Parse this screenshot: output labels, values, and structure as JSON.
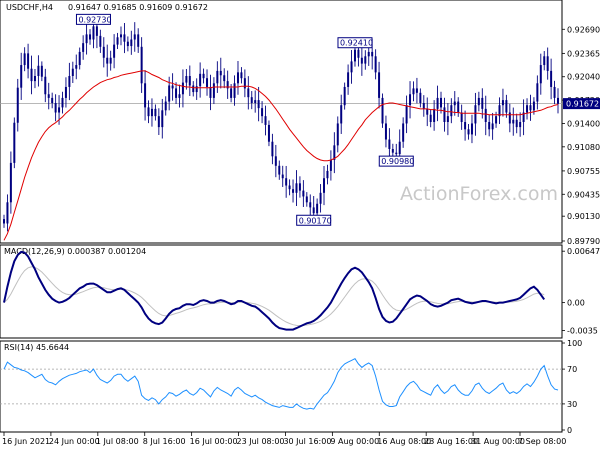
{
  "chart_data": {
    "type": "candlestick",
    "header": {
      "symbol": "USDCHF,H4",
      "ohlc": "0.91647 0.91685 0.91609 0.91672"
    },
    "watermark": "ActionForex.com",
    "colors": {
      "price": "#000080",
      "ma": "#e00000",
      "macd": "#000080",
      "signal": "#c0c0c0",
      "rsi": "#1e90ff",
      "last_price_bg": "#000080",
      "annotation_border": "#000080"
    },
    "x_tick_labels": [
      "16 Jun 2021",
      "24 Jun 00:00",
      "1 Jul 08:00",
      "8 Jul 16:00",
      "16 Jul 00:00",
      "23 Jul 08:00",
      "30 Jul 16:00",
      "9 Aug 00:00",
      "16 Aug 08:00",
      "23 Aug 16:00",
      "31 Aug 00:00",
      "7 Sep 08:00"
    ],
    "price_panel": {
      "ylim": [
        0.8979,
        0.9305
      ],
      "y_ticks": [
        0.9269,
        0.9236,
        0.9204,
        0.9172,
        0.914,
        0.9108,
        0.9075,
        0.9043,
        0.9013,
        0.8979
      ],
      "y_tick_labels": [
        "0.92690",
        "0.92365",
        "0.92040",
        "0.91720",
        "0.91400",
        "0.91080",
        "0.90755",
        "0.90435",
        "0.90130",
        "0.89790"
      ],
      "last_price": 0.91672,
      "last_price_label": "0.91672",
      "annotations": [
        {
          "x_index": 26,
          "value": 0.9273,
          "label": "0.92730",
          "placement": "above"
        },
        {
          "x_index": 90,
          "value": 0.9017,
          "label": "0.90170",
          "placement": "below"
        },
        {
          "x_index": 102,
          "value": 0.9241,
          "label": "0.92410",
          "placement": "above"
        },
        {
          "x_index": 114,
          "value": 0.9098,
          "label": "0.90980",
          "placement": "below"
        }
      ],
      "close": [
        0.9003,
        0.9032,
        0.9086,
        0.9141,
        0.9189,
        0.922,
        0.9236,
        0.9215,
        0.9198,
        0.9205,
        0.9219,
        0.9204,
        0.918,
        0.9175,
        0.9168,
        0.9155,
        0.9162,
        0.9175,
        0.919,
        0.9205,
        0.9215,
        0.922,
        0.9238,
        0.925,
        0.9262,
        0.9255,
        0.9273,
        0.926,
        0.9245,
        0.923,
        0.9222,
        0.923,
        0.9248,
        0.9258,
        0.9262,
        0.9252,
        0.9246,
        0.9255,
        0.9262,
        0.9245,
        0.9195,
        0.9162,
        0.915,
        0.916,
        0.915,
        0.9135,
        0.9158,
        0.917,
        0.9192,
        0.9188,
        0.9175,
        0.918,
        0.9196,
        0.9205,
        0.9192,
        0.9183,
        0.9191,
        0.9208,
        0.9202,
        0.919,
        0.9175,
        0.9195,
        0.9212,
        0.9206,
        0.9198,
        0.9188,
        0.9175,
        0.9195,
        0.921,
        0.9202,
        0.9188,
        0.9176,
        0.9168,
        0.9172,
        0.9161,
        0.915,
        0.9138,
        0.9115,
        0.9095,
        0.9082,
        0.907,
        0.9065,
        0.9055,
        0.905,
        0.9045,
        0.9058,
        0.9048,
        0.904,
        0.9032,
        0.9025,
        0.9017,
        0.903,
        0.9045,
        0.9065,
        0.9075,
        0.909,
        0.911,
        0.914,
        0.9165,
        0.919,
        0.921,
        0.9225,
        0.9241,
        0.923,
        0.9222,
        0.9232,
        0.9238,
        0.9232,
        0.921,
        0.9175,
        0.914,
        0.9118,
        0.9105,
        0.91,
        0.9098,
        0.9115,
        0.914,
        0.9165,
        0.918,
        0.9188,
        0.9182,
        0.9168,
        0.916,
        0.9152,
        0.9142,
        0.916,
        0.9175,
        0.9162,
        0.9142,
        0.915,
        0.9165,
        0.917,
        0.9155,
        0.9142,
        0.9132,
        0.9125,
        0.914,
        0.9165,
        0.9175,
        0.916,
        0.9142,
        0.9132,
        0.914,
        0.915,
        0.9165,
        0.9172,
        0.9155,
        0.914,
        0.9145,
        0.9135,
        0.9142,
        0.9155,
        0.9165,
        0.9158,
        0.917,
        0.9195,
        0.922,
        0.9232,
        0.9212,
        0.919,
        0.9175,
        0.9167
      ],
      "ma": [
        0.898,
        0.8989,
        0.9002,
        0.9018,
        0.9034,
        0.905,
        0.9066,
        0.908,
        0.9093,
        0.9104,
        0.9114,
        0.9122,
        0.9129,
        0.9134,
        0.9138,
        0.9141,
        0.9145,
        0.9149,
        0.9154,
        0.9158,
        0.9163,
        0.9168,
        0.9173,
        0.9177,
        0.9182,
        0.9186,
        0.919,
        0.9193,
        0.9196,
        0.9198,
        0.92,
        0.9201,
        0.9203,
        0.9204,
        0.9206,
        0.9207,
        0.9208,
        0.9209,
        0.921,
        0.9211,
        0.9212,
        0.9212,
        0.921,
        0.9207,
        0.9205,
        0.9203,
        0.92,
        0.9198,
        0.9196,
        0.9195,
        0.9193,
        0.9192,
        0.9191,
        0.919,
        0.919,
        0.9189,
        0.9189,
        0.9189,
        0.9189,
        0.9189,
        0.9189,
        0.919,
        0.919,
        0.919,
        0.919,
        0.919,
        0.919,
        0.919,
        0.919,
        0.9191,
        0.9191,
        0.9191,
        0.919,
        0.9188,
        0.9185,
        0.9181,
        0.9177,
        0.9172,
        0.9166,
        0.916,
        0.9153,
        0.9146,
        0.9139,
        0.9132,
        0.9126,
        0.912,
        0.9114,
        0.9108,
        0.9103,
        0.9099,
        0.9095,
        0.9092,
        0.909,
        0.9089,
        0.9089,
        0.909,
        0.9092,
        0.9095,
        0.91,
        0.9105,
        0.9111,
        0.9118,
        0.9125,
        0.9132,
        0.9138,
        0.9145,
        0.915,
        0.9155,
        0.9159,
        0.9163,
        0.9166,
        0.9167,
        0.9168,
        0.9168,
        0.9167,
        0.9166,
        0.9165,
        0.9164,
        0.9163,
        0.9162,
        0.9161,
        0.916,
        0.916,
        0.916,
        0.9159,
        0.9159,
        0.9158,
        0.9158,
        0.9157,
        0.9156,
        0.9156,
        0.9155,
        0.9155,
        0.9154,
        0.9154,
        0.9154,
        0.9154,
        0.9154,
        0.9154,
        0.9153,
        0.9153,
        0.9152,
        0.9152,
        0.9152,
        0.9152,
        0.9152,
        0.9152,
        0.9152,
        0.9152,
        0.9152,
        0.9152,
        0.9153,
        0.9154,
        0.9155,
        0.9156,
        0.9157,
        0.9158,
        0.916,
        0.9162,
        0.9163,
        0.9165,
        0.9166
      ]
    },
    "macd_panel": {
      "label": "MACD(12,26,9) 0.000387 0.001204",
      "ylim": [
        -0.0042,
        0.007
      ],
      "y_ticks": [
        0.006473,
        0.0,
        -0.0035
      ],
      "y_tick_labels": [
        "0.006473",
        "0.00",
        "-0.0035"
      ],
      "macd": [
        0.0,
        0.002,
        0.0038,
        0.0052,
        0.006,
        0.0064,
        0.0063,
        0.0058,
        0.005,
        0.0042,
        0.0032,
        0.0024,
        0.0016,
        0.001,
        0.0005,
        0.0002,
        0.0,
        0.0001,
        0.0003,
        0.0006,
        0.001,
        0.0014,
        0.0018,
        0.002,
        0.0023,
        0.0024,
        0.0024,
        0.0022,
        0.0019,
        0.0016,
        0.0013,
        0.0013,
        0.0015,
        0.0017,
        0.0018,
        0.0016,
        0.0012,
        0.0008,
        0.0004,
        0.0,
        -0.0006,
        -0.0014,
        -0.002,
        -0.0024,
        -0.0026,
        -0.0027,
        -0.0025,
        -0.002,
        -0.0014,
        -0.001,
        -0.0008,
        -0.0007,
        -0.0004,
        -0.0002,
        -0.0002,
        -0.0003,
        -0.0001,
        0.0002,
        0.0003,
        0.0002,
        0.0,
        0.0,
        0.0002,
        0.0003,
        0.0002,
        0.0,
        -0.0002,
        -0.0001,
        0.0002,
        0.0002,
        0.0,
        -0.0002,
        -0.0004,
        -0.0005,
        -0.0008,
        -0.0012,
        -0.0016,
        -0.002,
        -0.0025,
        -0.0029,
        -0.0032,
        -0.0033,
        -0.0034,
        -0.0034,
        -0.0034,
        -0.0032,
        -0.003,
        -0.0028,
        -0.0026,
        -0.0025,
        -0.0023,
        -0.002,
        -0.0016,
        -0.0011,
        -0.0006,
        0.0,
        0.0008,
        0.0016,
        0.0024,
        0.0031,
        0.0037,
        0.0042,
        0.0044,
        0.0042,
        0.0038,
        0.0032,
        0.0026,
        0.0018,
        0.0006,
        -0.0008,
        -0.0018,
        -0.0023,
        -0.0025,
        -0.0024,
        -0.002,
        -0.0014,
        -0.0008,
        -0.0002,
        0.0004,
        0.0007,
        0.0009,
        0.0008,
        0.0005,
        0.0002,
        -0.0002,
        -0.0004,
        -0.0005,
        -0.0004,
        -0.0002,
        0.0,
        0.0003,
        0.0004,
        0.0005,
        0.0003,
        0.0001,
        0.0,
        -0.0001,
        0.0,
        0.0001,
        0.0002,
        0.0002,
        0.0001,
        0.0,
        -0.0001,
        0.0,
        0.0,
        0.0001,
        0.0002,
        0.0003,
        0.0004,
        0.0006,
        0.001,
        0.0014,
        0.0018,
        0.002,
        0.0016,
        0.001,
        0.0004
      ]
    },
    "rsi_panel": {
      "label": "RSI(14) 45.6644",
      "ylim": [
        0,
        100
      ],
      "y_ticks": [
        100,
        70,
        30,
        0
      ],
      "y_tick_labels": [
        "100",
        "70",
        "30",
        "0"
      ],
      "rsi": [
        70,
        78,
        75,
        72,
        71,
        69,
        68,
        66,
        63,
        60,
        62,
        64,
        58,
        55,
        54,
        52,
        56,
        59,
        61,
        63,
        64,
        65,
        67,
        68,
        69,
        66,
        70,
        63,
        58,
        56,
        54,
        57,
        62,
        64,
        64,
        59,
        56,
        59,
        62,
        56,
        40,
        36,
        34,
        37,
        35,
        30,
        35,
        38,
        43,
        42,
        39,
        41,
        44,
        46,
        42,
        40,
        43,
        48,
        46,
        42,
        38,
        45,
        49,
        46,
        44,
        42,
        39,
        46,
        49,
        46,
        42,
        40,
        38,
        40,
        37,
        35,
        32,
        30,
        28,
        27,
        26,
        28,
        27,
        26,
        26,
        30,
        27,
        25,
        24,
        25,
        24,
        30,
        35,
        40,
        43,
        49,
        56,
        66,
        72,
        76,
        78,
        80,
        82,
        76,
        72,
        75,
        77,
        74,
        62,
        46,
        33,
        29,
        27,
        27,
        28,
        38,
        44,
        50,
        54,
        56,
        52,
        46,
        44,
        42,
        40,
        48,
        52,
        46,
        42,
        45,
        50,
        52,
        46,
        42,
        40,
        40,
        45,
        52,
        54,
        48,
        44,
        42,
        45,
        48,
        52,
        54,
        46,
        42,
        44,
        42,
        45,
        50,
        53,
        50,
        55,
        62,
        70,
        74,
        62,
        52,
        47,
        46
      ]
    }
  }
}
